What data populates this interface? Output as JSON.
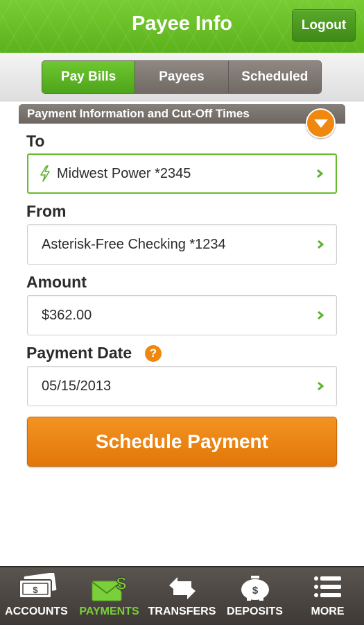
{
  "header": {
    "title": "Payee Info",
    "logout_label": "Logout"
  },
  "tabs": [
    {
      "label": "Pay Bills",
      "active": true
    },
    {
      "label": "Payees",
      "active": false
    },
    {
      "label": "Scheduled",
      "active": false
    }
  ],
  "info_strip": {
    "label": "Payment Information and Cut-Off Times"
  },
  "form": {
    "to": {
      "label": "To",
      "value": "Midwest Power *2345",
      "icon": "lightning-icon"
    },
    "from": {
      "label": "From",
      "value": "Asterisk-Free Checking *1234"
    },
    "amount": {
      "label": "Amount",
      "value": "$362.00"
    },
    "payment_date": {
      "label": "Payment Date",
      "value": "05/15/2013",
      "help": "?"
    }
  },
  "schedule_button": {
    "label": "Schedule Payment"
  },
  "bottom_nav": [
    {
      "label": "ACCOUNTS",
      "icon": "cash-icon",
      "active": false
    },
    {
      "label": "PAYMENTS",
      "icon": "envelope-dollar-icon",
      "active": true
    },
    {
      "label": "TRANSFERS",
      "icon": "transfer-arrows-icon",
      "active": false
    },
    {
      "label": "DEPOSITS",
      "icon": "piggy-bank-icon",
      "active": false
    },
    {
      "label": "MORE",
      "icon": "menu-list-icon",
      "active": false
    }
  ],
  "colors": {
    "brand_green": "#6cc22a",
    "accent_orange": "#f0870f",
    "nav_dark": "#4a4541"
  }
}
